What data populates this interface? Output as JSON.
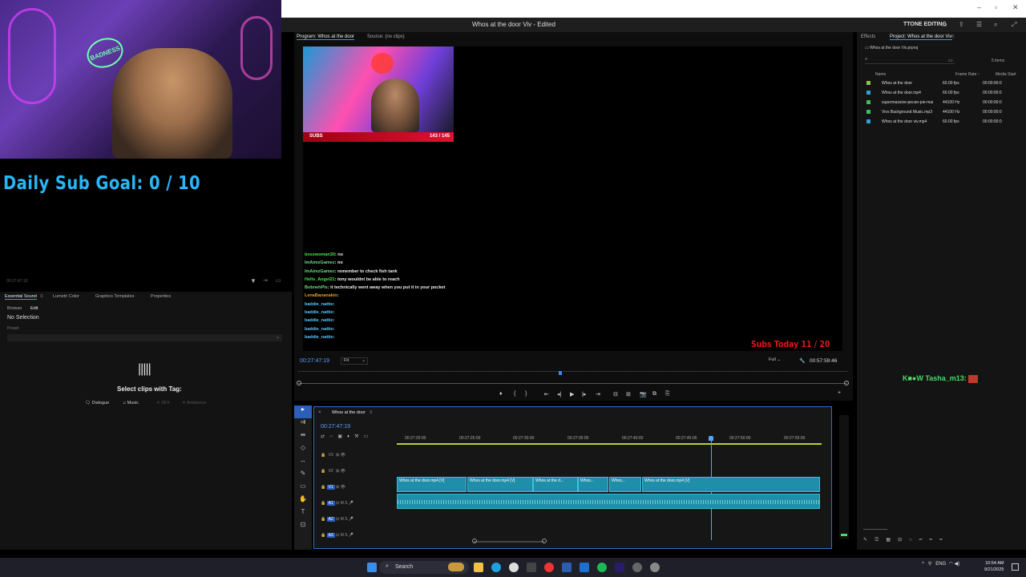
{
  "overlay": {
    "sub_goal": "Daily Sub Goal:  0 / 10",
    "webcam_logo": "BADNESS",
    "subs_label": "SUBS",
    "subs_count": "143 / 145",
    "subs_today": "Subs Today  11 / 20",
    "tasha": "Tasha_m13:",
    "chat": [
      {
        "user": "bosswoman30",
        "msg": ": no",
        "cls": "n1"
      },
      {
        "user": "ImAimzGamez",
        "msg": ": no",
        "cls": "n2"
      },
      {
        "user": "ImAimzGamez",
        "msg": ": remember to check fish tank",
        "cls": "n2"
      },
      {
        "user": "Hells_Angel21",
        "msg": ": tony wouldnt be able to reach",
        "cls": "n1"
      },
      {
        "user": "BobnehPls",
        "msg": ": it technically went away when you put it in your pocket",
        "cls": "n2"
      },
      {
        "user": "LenaBananakin",
        "msg": ":",
        "cls": "n3"
      },
      {
        "user": "baddie_nattie",
        "msg": ":",
        "cls": "n4"
      },
      {
        "user": "baddie_nattie",
        "msg": ":",
        "cls": "n4"
      },
      {
        "user": "baddie_nattie",
        "msg": ":",
        "cls": "n4"
      },
      {
        "user": "baddie_nattie",
        "msg": ":",
        "cls": "n4"
      },
      {
        "user": "baddie_nattie",
        "msg": ":",
        "cls": "n4"
      }
    ]
  },
  "window": {
    "title": "Whos at the door Viv - Edited",
    "workspace": "TTONE EDITING"
  },
  "monitor": {
    "tab_program": "Program: Whos at the door",
    "tab_source": "Source: (no clips)",
    "timecode": "00:27:47:19",
    "fit": "Fit",
    "quality": "Full",
    "duration": "00:57:59:46"
  },
  "left_panel": {
    "timecode": "00:27:47:19",
    "tabs": [
      "Essential Sound",
      "Lumetri Color",
      "Graphics Templates",
      "Properties"
    ],
    "subtabs": [
      "Browse",
      "Edit"
    ],
    "no_selection": "No Selection",
    "preset": "Preset",
    "select_clips": "Select clips with Tag:",
    "tags": [
      "Dialogue",
      "Music",
      "SFX",
      "Ambience"
    ]
  },
  "timeline": {
    "sequence": "Whos at the door",
    "timecode": "00:27:47:19",
    "ruler": [
      "00:27:20:00",
      "00:27:25:00",
      "00:27:30:00",
      "00:27:35:00",
      "00:27:40:00",
      "00:27:45:00",
      "00:27:50:00",
      "00:27:55:00"
    ],
    "tracks_video": [
      "V3",
      "V2",
      "V1"
    ],
    "tracks_audio": [
      "A1",
      "A2",
      "A3"
    ],
    "clips": [
      "Whos at the door.mp4 [V]",
      "Whos at the door.mp4 [V]",
      "Whos at the d...",
      "Whos...",
      "Whos...",
      "Whos at the door.mp4 [V]"
    ]
  },
  "project": {
    "tab_effects": "Effects",
    "tab_project": "Project: Whos at the door Viv",
    "file": "Whos at the door Viv.prproj",
    "count": "5 items",
    "col_name": "Name",
    "col_fps": "Frame Rate",
    "col_start": "Media Start",
    "items": [
      {
        "name": "Whos at the door",
        "rate": "60.00 fps",
        "start": "00:00:00:0",
        "color": "#8bc34a"
      },
      {
        "name": "Whos at the door.mp4",
        "rate": "60.00 fps",
        "start": "00:00:00:0",
        "color": "#2ea0d6"
      },
      {
        "name": "supermassive-pecan-pie-mai",
        "rate": "44100 Hz",
        "start": "00:00:00:0",
        "color": "#3dbf5a"
      },
      {
        "name": "Vivs Background Music.mp3",
        "rate": "44100 Hz",
        "start": "00:00:00:0",
        "color": "#3dbf5a"
      },
      {
        "name": "Whos at the door viv.mp4",
        "rate": "60.00 fps",
        "start": "00:00:00:0",
        "color": "#2ea0d6"
      }
    ]
  },
  "taskbar": {
    "search": "Search",
    "lang": "ENG",
    "time": "10:54 AM",
    "date": "9/21/2025"
  },
  "colors": {
    "accent": "#2b5fb8",
    "clip": "#1f8ea8",
    "timecode": "#5aa0ff"
  }
}
